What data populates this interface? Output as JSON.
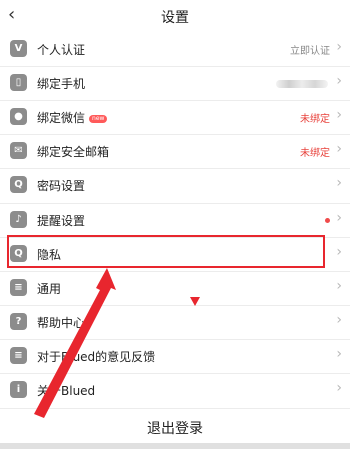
{
  "header": {
    "back_icon": "chevron-left-icon",
    "title": "设置"
  },
  "rows": [
    {
      "label": "个人认证",
      "value": "立即认证",
      "icon": "V"
    },
    {
      "label": "绑定手机",
      "value": "",
      "icon": "▯"
    },
    {
      "label": "绑定微信",
      "badge": "new",
      "value": "未绑定",
      "icon": "●"
    },
    {
      "label": "绑定安全邮箱",
      "value": "未绑定",
      "icon": "✉"
    },
    {
      "label": "密码设置",
      "value": "",
      "icon": "Q"
    },
    {
      "label": "提醒设置",
      "value": "",
      "icon": "♪"
    },
    {
      "label": "隐私",
      "value": "",
      "icon": "Q"
    },
    {
      "label": "通用",
      "value": "",
      "icon": "≡"
    },
    {
      "label": "帮助中心",
      "value": "",
      "icon": "?"
    },
    {
      "label": "对于Blued的意见反馈",
      "value": "",
      "icon": "≡"
    },
    {
      "label": "关于Blued",
      "value": "",
      "icon": "i"
    }
  ],
  "logout": "退出登录",
  "colors": {
    "accent": "#e8262e",
    "status_red": "#e8433d"
  }
}
